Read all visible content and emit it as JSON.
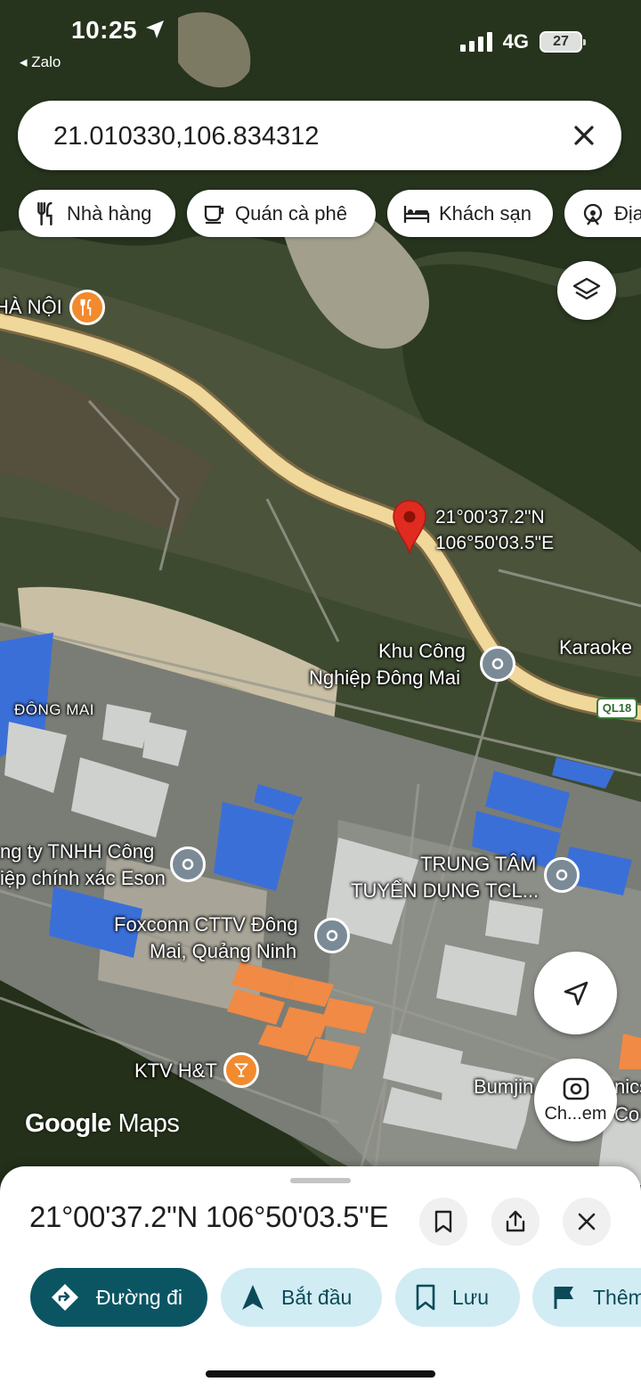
{
  "status_bar": {
    "time": "10:25",
    "back_label": "◂ Zalo",
    "network": "4G",
    "battery": "27"
  },
  "search": {
    "value": "21.010330,106.834312"
  },
  "chips": [
    {
      "label": "Nhà hàng",
      "icon": "restaurant-icon"
    },
    {
      "label": "Quán cà phê",
      "icon": "coffee-icon"
    },
    {
      "label": "Khách sạn",
      "icon": "hotel-icon"
    },
    {
      "label": "Địa",
      "icon": "attraction-icon"
    }
  ],
  "map": {
    "pin_coordinates": [
      "21°00'37.2\"N",
      "106°50'03.5\"E"
    ],
    "labels": {
      "ha_noi": "HÀ NỘI",
      "khu_cong_nghiep": [
        "Khu Công",
        "Nghiệp Đông Mai"
      ],
      "karaoke": "Karaoke",
      "dong_mai": "ĐÔNG MAI",
      "eson": [
        "ng ty TNHH Công",
        "iệp chính xác Eson"
      ],
      "trung_tam": [
        "TRUNG TÂM",
        "TUYỂN DỤNG TCL..."
      ],
      "foxconn": [
        "Foxconn CTTV Đông",
        "Mai, Quảng Ninh"
      ],
      "ktv": "KTV H&T",
      "bumjin": "Bumjin",
      "bumjin_tail": "nics",
      "co": "Co",
      "road": "QL18"
    },
    "lens_label": "Ch...em",
    "watermark_google": "Google",
    "watermark_maps": "Maps",
    "colors": {
      "road": "#f0d79a",
      "pin": "#e02b20",
      "poi_orange": "#f28a2e",
      "poi_gray": "#7a8a96",
      "factory_blue": "#3b6fd8",
      "factory_orange": "#f08a45"
    }
  },
  "sheet": {
    "title": "21°00'37.2\"N 106°50'03.5\"E",
    "actions": [
      {
        "label": "Đường đi",
        "icon": "directions-icon"
      },
      {
        "label": "Bắt đầu",
        "icon": "navigation-arrow-icon"
      },
      {
        "label": "Lưu",
        "icon": "bookmark-icon"
      },
      {
        "label": "Thêm",
        "icon": "flag-icon"
      }
    ]
  }
}
